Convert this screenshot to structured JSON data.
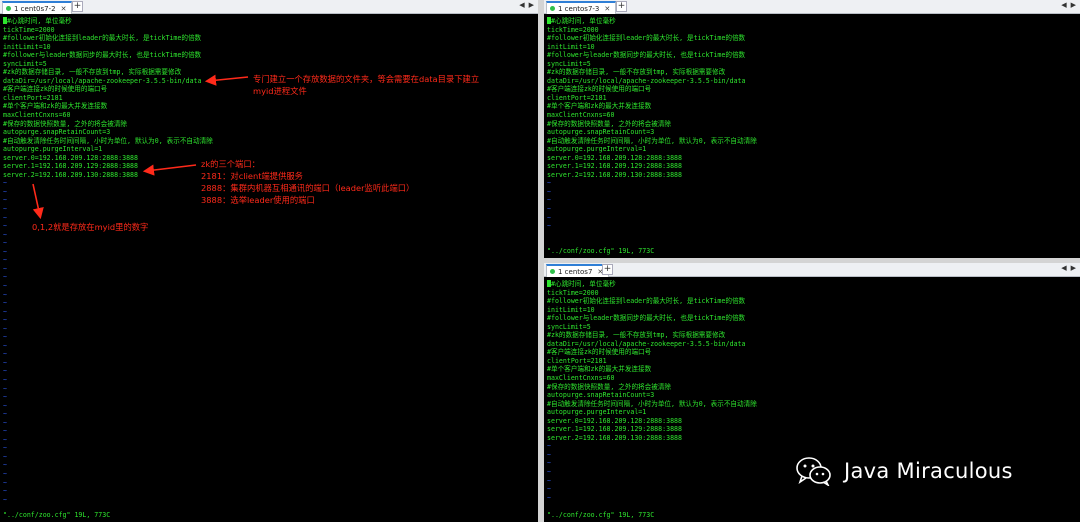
{
  "panes": {
    "left": {
      "tab_label": "1 cent0s7-2",
      "status": "\"../conf/zoo.cfg\" 19L, 773C"
    },
    "top_right": {
      "tab_label": "1 centos7-3",
      "status": "\"../conf/zoo.cfg\" 19L, 773C"
    },
    "bottom_right": {
      "tab_label": "1 centos7",
      "status": "\"../conf/zoo.cfg\" 19L, 773C"
    }
  },
  "config_lines": [
    "#心跳时间, 单位毫秒",
    "tickTime=2000",
    "#follower初始化连接到leader的最大时长, 是tickTime的倍数",
    "initLimit=10",
    "#follower与leader数据同步的最大时长, 也是tickTime的倍数",
    "syncLimit=5",
    "#zk的数据存储目录, 一般不存放到tmp, 实际根据需要修改",
    "dataDir=/usr/local/apache-zookeeper-3.5.5-bin/data",
    "#客户端连接zk的时候使用的端口号",
    "clientPort=2181",
    "#单个客户端和zk的最大并发连接数",
    "maxClientCnxns=60",
    "#保存的数据快照数量, 之外的将会被清除",
    "autopurge.snapRetainCount=3",
    "#自动触发清除任务时间间隔, 小时为单位, 默认为0, 表示不自动清除",
    "autopurge.purgeInterval=1",
    "server.0=192.168.209.128:2888:3888",
    "server.1=192.168.209.129:2888:3888",
    "server.2=192.168.209.130:2888:3888"
  ],
  "tilde": "~",
  "annotations": {
    "datadir_note_1": "专门建立一个存放数据的文件夹，等会需要在data目录下建立",
    "datadir_note_2": "myid进程文件",
    "ports_title": "zk的三个端口：",
    "port_2181": "2181：对client端提供服务",
    "port_2888": "2888：集群内机器互相通讯的端口（leader监听此端口）",
    "port_3888": "3888：选举leader使用的端口",
    "myid_note": "0,1,2就是存放在myid里的数字"
  },
  "watermark": {
    "text": "Java Miraculous",
    "icon": "wechat-icon"
  },
  "colors": {
    "terminal_text": "#2ee62e",
    "tilde": "#2a52d8",
    "annotation": "#ff2a1a",
    "tab_active": "#2f7fd6"
  }
}
